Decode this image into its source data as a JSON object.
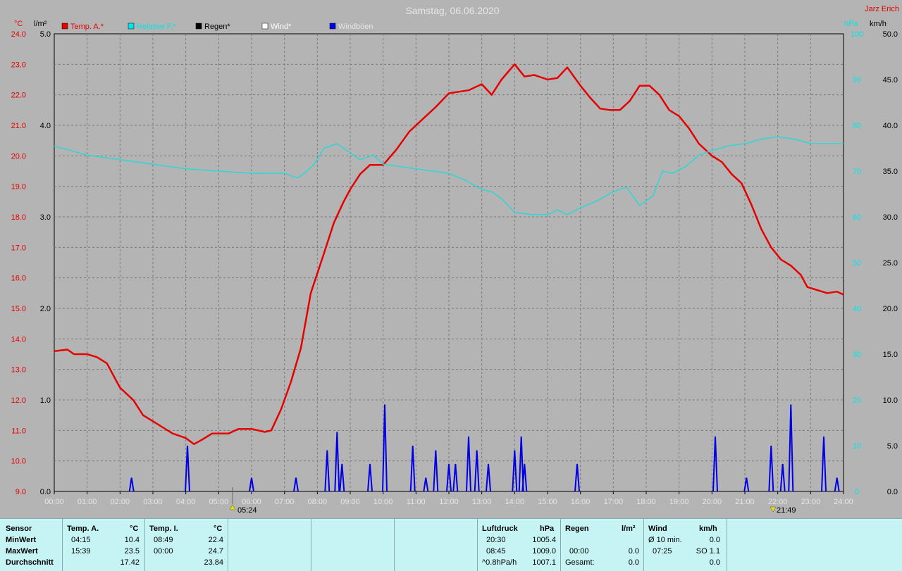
{
  "header": {
    "title": "Samstag, 06.06.2020",
    "station_owner": "Jarz Erich"
  },
  "axis_units": {
    "left_temp": "°C",
    "left_rain": "l/m²",
    "right_pressure": "hPa",
    "right_wind": "km/h"
  },
  "legend": [
    {
      "label": "Temp. A.*",
      "color": "#e60000"
    },
    {
      "label": "Relative F.*",
      "color": "#00e6e6"
    },
    {
      "label": "Regen*",
      "color": "#000000"
    },
    {
      "label": "Wind*",
      "color": "#ffffff"
    },
    {
      "label": "Windböen",
      "color": "#0000e6"
    }
  ],
  "chart_data": {
    "type": "line",
    "title": "Samstag, 06.06.2020",
    "x_labels": [
      "00:00",
      "01:00",
      "02:00",
      "03:00",
      "04:00",
      "05:00",
      "06:00",
      "07:00",
      "08:00",
      "09:00",
      "10:00",
      "11:00",
      "12:00",
      "13:00",
      "14:00",
      "15:00",
      "16:00",
      "17:00",
      "18:00",
      "19:00",
      "20:00",
      "21:00",
      "22:00",
      "23:00",
      "24:00"
    ],
    "y_temp": {
      "unit": "°C",
      "range": [
        9.0,
        24.0
      ],
      "ticks": [
        "24.0",
        "23.0",
        "22.0",
        "21.0",
        "20.0",
        "19.0",
        "18.0",
        "17.0",
        "16.0",
        "15.0",
        "14.0",
        "13.0",
        "12.0",
        "11.0",
        "10.0",
        "9.0"
      ]
    },
    "y_rain": {
      "unit": "l/m²",
      "range": [
        0.0,
        5.0
      ],
      "ticks": [
        "5.0",
        "4.0",
        "3.0",
        "2.0",
        "1.0",
        "0.0"
      ]
    },
    "y_pressure": {
      "unit": "hPa",
      "ticks": [
        "100",
        "90",
        "80",
        "70",
        "60",
        "50",
        "40",
        "30",
        "20",
        "10",
        "0"
      ]
    },
    "y_wind": {
      "unit": "km/h",
      "range": [
        0.0,
        50.0
      ],
      "ticks": [
        "50.0",
        "45.0",
        "40.0",
        "35.0",
        "30.0",
        "25.0",
        "20.0",
        "15.0",
        "10.0",
        "5.0",
        "0.0"
      ]
    },
    "grid": true,
    "series": [
      {
        "name": "Temp. A.*",
        "color": "#e60000",
        "axis": "y_temp",
        "points": [
          [
            0.0,
            13.6
          ],
          [
            0.4,
            13.65
          ],
          [
            0.6,
            13.5
          ],
          [
            1.0,
            13.5
          ],
          [
            1.3,
            13.4
          ],
          [
            1.6,
            13.2
          ],
          [
            2.0,
            12.4
          ],
          [
            2.4,
            12.0
          ],
          [
            2.7,
            11.5
          ],
          [
            3.0,
            11.3
          ],
          [
            3.3,
            11.1
          ],
          [
            3.6,
            10.9
          ],
          [
            4.0,
            10.75
          ],
          [
            4.25,
            10.55
          ],
          [
            4.5,
            10.7
          ],
          [
            4.8,
            10.9
          ],
          [
            5.0,
            10.9
          ],
          [
            5.3,
            10.9
          ],
          [
            5.6,
            11.05
          ],
          [
            6.0,
            11.05
          ],
          [
            6.4,
            10.95
          ],
          [
            6.6,
            11.0
          ],
          [
            6.9,
            11.7
          ],
          [
            7.2,
            12.6
          ],
          [
            7.5,
            13.7
          ],
          [
            7.8,
            15.5
          ],
          [
            8.2,
            16.8
          ],
          [
            8.5,
            17.8
          ],
          [
            8.8,
            18.5
          ],
          [
            9.0,
            18.9
          ],
          [
            9.3,
            19.4
          ],
          [
            9.6,
            19.7
          ],
          [
            10.0,
            19.7
          ],
          [
            10.4,
            20.2
          ],
          [
            10.8,
            20.8
          ],
          [
            11.2,
            21.2
          ],
          [
            11.6,
            21.6
          ],
          [
            12.0,
            22.05
          ],
          [
            12.3,
            22.1
          ],
          [
            12.6,
            22.15
          ],
          [
            13.0,
            22.35
          ],
          [
            13.3,
            22.0
          ],
          [
            13.6,
            22.5
          ],
          [
            14.0,
            23.0
          ],
          [
            14.3,
            22.6
          ],
          [
            14.6,
            22.65
          ],
          [
            15.0,
            22.5
          ],
          [
            15.3,
            22.55
          ],
          [
            15.6,
            22.9
          ],
          [
            16.0,
            22.3
          ],
          [
            16.3,
            21.9
          ],
          [
            16.6,
            21.55
          ],
          [
            16.9,
            21.5
          ],
          [
            17.2,
            21.5
          ],
          [
            17.5,
            21.8
          ],
          [
            17.8,
            22.3
          ],
          [
            18.1,
            22.3
          ],
          [
            18.4,
            22.0
          ],
          [
            18.7,
            21.5
          ],
          [
            19.0,
            21.3
          ],
          [
            19.3,
            20.9
          ],
          [
            19.6,
            20.4
          ],
          [
            20.0,
            20.0
          ],
          [
            20.3,
            19.8
          ],
          [
            20.6,
            19.4
          ],
          [
            20.9,
            19.1
          ],
          [
            21.2,
            18.4
          ],
          [
            21.5,
            17.6
          ],
          [
            21.8,
            17.0
          ],
          [
            22.1,
            16.6
          ],
          [
            22.4,
            16.4
          ],
          [
            22.7,
            16.1
          ],
          [
            22.9,
            15.7
          ],
          [
            23.2,
            15.6
          ],
          [
            23.5,
            15.5
          ],
          [
            23.8,
            15.55
          ],
          [
            24.0,
            15.45
          ]
        ]
      },
      {
        "name": "Relative F.*",
        "color": "#2ed6d6",
        "axis": "y_pressure",
        "points": [
          [
            0.0,
            75.5
          ],
          [
            1.0,
            73.5
          ],
          [
            2.0,
            72.5
          ],
          [
            3.0,
            71.5
          ],
          [
            4.0,
            70.5
          ],
          [
            5.0,
            70.0
          ],
          [
            6.0,
            69.5
          ],
          [
            7.0,
            69.5
          ],
          [
            7.4,
            68.5
          ],
          [
            7.6,
            69.5
          ],
          [
            7.9,
            71.5
          ],
          [
            8.2,
            75.0
          ],
          [
            8.6,
            76.0
          ],
          [
            9.0,
            74.0
          ],
          [
            9.3,
            72.5
          ],
          [
            9.7,
            73.5
          ],
          [
            10.0,
            71.5
          ],
          [
            10.5,
            71.0
          ],
          [
            11.0,
            70.5
          ],
          [
            11.5,
            70.0
          ],
          [
            12.0,
            69.5
          ],
          [
            12.5,
            68.0
          ],
          [
            13.0,
            66.0
          ],
          [
            13.3,
            65.5
          ],
          [
            13.6,
            64.0
          ],
          [
            14.0,
            61.0
          ],
          [
            14.5,
            60.5
          ],
          [
            15.0,
            60.5
          ],
          [
            15.3,
            61.5
          ],
          [
            15.6,
            60.5
          ],
          [
            16.0,
            62.0
          ],
          [
            16.5,
            63.5
          ],
          [
            17.0,
            65.5
          ],
          [
            17.4,
            66.5
          ],
          [
            17.8,
            62.5
          ],
          [
            18.2,
            64.5
          ],
          [
            18.5,
            70.0
          ],
          [
            18.8,
            69.5
          ],
          [
            19.2,
            71.0
          ],
          [
            19.6,
            73.5
          ],
          [
            20.0,
            74.5
          ],
          [
            20.5,
            75.5
          ],
          [
            21.0,
            76.0
          ],
          [
            21.5,
            77.0
          ],
          [
            22.0,
            77.5
          ],
          [
            22.5,
            77.0
          ],
          [
            23.0,
            76.0
          ],
          [
            24.0,
            76.0
          ]
        ]
      },
      {
        "name": "Windböen",
        "color": "#0000e6",
        "axis": "y_wind",
        "points": [
          [
            2.35,
            1.5
          ],
          [
            4.05,
            5.0
          ],
          [
            6.0,
            1.5
          ],
          [
            7.35,
            1.5
          ],
          [
            8.3,
            4.5
          ],
          [
            8.6,
            6.5
          ],
          [
            8.75,
            3.0
          ],
          [
            9.6,
            3.0
          ],
          [
            10.05,
            9.5
          ],
          [
            10.9,
            5.0
          ],
          [
            11.3,
            1.5
          ],
          [
            11.6,
            4.5
          ],
          [
            12.0,
            3.0
          ],
          [
            12.2,
            3.0
          ],
          [
            12.6,
            6.0
          ],
          [
            12.85,
            4.5
          ],
          [
            13.2,
            3.0
          ],
          [
            14.0,
            4.5
          ],
          [
            14.2,
            6.0
          ],
          [
            14.3,
            3.0
          ],
          [
            15.9,
            3.0
          ],
          [
            20.1,
            6.0
          ],
          [
            21.05,
            1.5
          ],
          [
            21.8,
            5.0
          ],
          [
            22.15,
            3.0
          ],
          [
            22.4,
            9.5
          ],
          [
            23.4,
            6.0
          ],
          [
            23.8,
            1.5
          ]
        ]
      }
    ],
    "annotations": [
      "05:24",
      "21:49"
    ]
  },
  "stats_panel": {
    "row_labels": [
      "Sensor",
      "MinWert",
      "MaxWert",
      "Durchschnitt"
    ],
    "temp_a": {
      "header": "Temp. A.",
      "unit": "°C",
      "min_time": "04:15",
      "min_value": "10.4",
      "max_time": "15:39",
      "max_value": "23.5",
      "avg": "17.42"
    },
    "temp_i": {
      "header": "Temp. I.",
      "unit": "°C",
      "min_time": "08:49",
      "min_value": "22.4",
      "max_time": "00:00",
      "max_value": "24.7",
      "avg": "23.84"
    },
    "pressure": {
      "header": "Luftdruck",
      "unit": "hPa",
      "min_time": "20:30",
      "min_value": "1005.4",
      "max_time": "08:45",
      "max_value": "1009.0",
      "trend_label": "^0.8hPa/h",
      "trend_value": "1007.1"
    },
    "rain": {
      "header": "Regen",
      "unit": "l/m²",
      "max_time": "00:00",
      "max_value": "0.0",
      "total_label": "Gesamt:",
      "total_value": "0.0"
    },
    "wind": {
      "header": "Wind",
      "unit": "km/h",
      "avg_label": "Ø 10 min.",
      "avg_value": "0.0",
      "max_time": "07:25",
      "max_value": "SO 1.1",
      "total_value": "0.0"
    }
  }
}
